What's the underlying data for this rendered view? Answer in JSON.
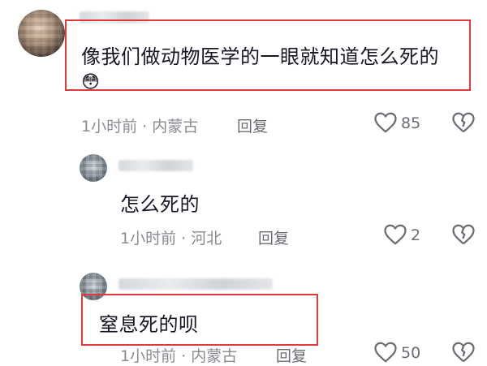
{
  "comments": [
    {
      "text": "像我们做动物医学的一眼就知道怎么死的",
      "emoji": "😳",
      "meta": "1小时前 · 内蒙古",
      "reply_label": "回复",
      "like_count": "85"
    },
    {
      "text": "怎么死的",
      "meta": "1小时前 · 河北",
      "reply_label": "回复",
      "like_count": "2"
    },
    {
      "text": "窒息死的呗",
      "meta": "1小时前 · 内蒙古",
      "reply_label": "回复",
      "like_count": "50"
    }
  ],
  "colors": {
    "highlight_box": "#e23a3a",
    "meta_text": "#8a8b91"
  },
  "icons": [
    "heart-icon",
    "broken-heart-icon",
    "flushed-face-emoji"
  ]
}
